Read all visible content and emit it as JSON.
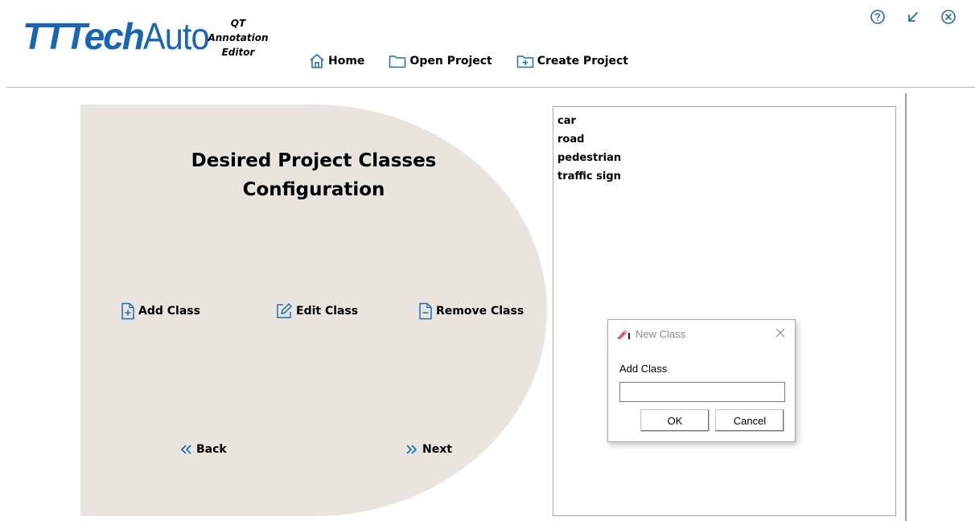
{
  "header": {
    "logo_bold": "TTTech",
    "logo_light": "Auto",
    "app_name_line1": "QT",
    "app_name_line2": "Annotation",
    "app_name_line3": "Editor",
    "nav": {
      "home": "Home",
      "open_project": "Open Project",
      "create_project": "Create Project"
    },
    "window_controls": [
      "help-icon",
      "minimize-icon",
      "close-icon"
    ]
  },
  "panel": {
    "title_line1": "Desired Project Classes",
    "title_line2": "Configuration",
    "add_class": "Add Class",
    "edit_class": "Edit Class",
    "remove_class": "Remove Class",
    "back": "Back",
    "next": "Next"
  },
  "class_list": {
    "items": [
      "car",
      "road",
      "pedestrian",
      "traffic sign"
    ]
  },
  "dialog": {
    "title": "New Class",
    "label": "Add Class",
    "input_value": "",
    "ok": "OK",
    "cancel": "Cancel"
  },
  "colors": {
    "brand": "#1565b8",
    "panel_bg": "#e9e5de",
    "icon_accent": "#1a6fb0"
  }
}
